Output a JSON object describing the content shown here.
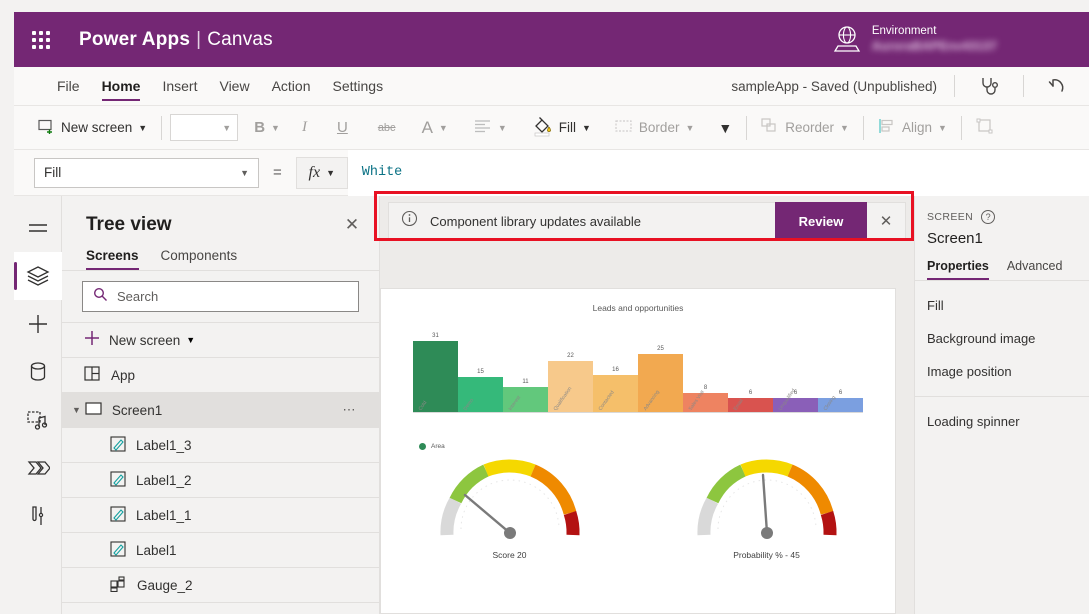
{
  "topbar": {
    "waffle_icon": "app-launcher-icon",
    "brand_product": "Power Apps",
    "brand_separator": "|",
    "brand_mode": "Canvas",
    "environment_icon": "environment-globe-icon",
    "environment_label": "Environment",
    "environment_name": "AuroraBAPEnv43137",
    "accent_color": "#742774"
  },
  "menubar": {
    "items": [
      {
        "label": "File",
        "active": false
      },
      {
        "label": "Home",
        "active": true
      },
      {
        "label": "Insert",
        "active": false
      },
      {
        "label": "View",
        "active": false
      },
      {
        "label": "Action",
        "active": false
      },
      {
        "label": "Settings",
        "active": false
      }
    ],
    "app_status": "sampleApp - Saved (Unpublished)",
    "checker_icon": "app-checker-stethoscope-icon",
    "undo_icon": "undo-icon"
  },
  "ribbon": {
    "new_screen_label": "New screen",
    "new_screen_icon": "new-screen-icon",
    "font_family_value": "",
    "bold_label": "B",
    "italic_label": "I",
    "underline_label": "U",
    "strikethrough_label": "abc",
    "font_color_label": "A",
    "align_icon": "align-left-icon",
    "fill_label": "Fill",
    "fill_icon": "paint-bucket-icon",
    "border_label": "Border",
    "border_icon": "border-icon",
    "overflow_icon": "chevron-down-icon",
    "reorder_label": "Reorder",
    "reorder_icon": "reorder-icon",
    "align_label": "Align",
    "align_label_icon": "align-objects-icon",
    "group_icon": "group-icon"
  },
  "formulabar": {
    "property_value": "Fill",
    "equals": "=",
    "fx_label": "fx",
    "formula_value": "White"
  },
  "rail": {
    "items": [
      {
        "name": "menu-hamburger-icon",
        "active": false
      },
      {
        "name": "tree-view-layers-icon",
        "active": true
      },
      {
        "name": "insert-plus-icon",
        "active": false
      },
      {
        "name": "data-cylinder-icon",
        "active": false
      },
      {
        "name": "media-icon",
        "active": false
      },
      {
        "name": "power-automate-icon",
        "active": false
      },
      {
        "name": "variables-tools-icon",
        "active": false
      }
    ]
  },
  "treeview": {
    "title": "Tree view",
    "close_icon": "close-icon",
    "tabs": [
      {
        "label": "Screens",
        "active": true
      },
      {
        "label": "Components",
        "active": false
      }
    ],
    "search_placeholder": "Search",
    "search_icon": "search-icon",
    "search_value": "",
    "new_screen_label": "New screen",
    "items": [
      {
        "label": "App",
        "icon": "app-icon",
        "level": 0,
        "selected": false,
        "expandable": false,
        "more": false
      },
      {
        "label": "Screen1",
        "icon": "screen-icon",
        "level": 0,
        "selected": true,
        "expandable": true,
        "more": true
      },
      {
        "label": "Label1_3",
        "icon": "label-icon",
        "level": 1,
        "selected": false,
        "expandable": false,
        "more": false
      },
      {
        "label": "Label1_2",
        "icon": "label-icon",
        "level": 1,
        "selected": false,
        "expandable": false,
        "more": false
      },
      {
        "label": "Label1_1",
        "icon": "label-icon",
        "level": 1,
        "selected": false,
        "expandable": false,
        "more": false
      },
      {
        "label": "Label1",
        "icon": "label-icon",
        "level": 1,
        "selected": false,
        "expandable": false,
        "more": false
      },
      {
        "label": "Gauge_2",
        "icon": "component-icon",
        "level": 1,
        "selected": false,
        "expandable": false,
        "more": false
      }
    ]
  },
  "notification": {
    "info_icon": "info-icon",
    "message": "Component library updates available",
    "button_label": "Review",
    "close_icon": "close-icon",
    "highlight_color": "#e81123"
  },
  "properties_panel": {
    "kicker": "SCREEN",
    "help_icon": "help-circle-icon",
    "selected_name": "Screen1",
    "tabs": [
      {
        "label": "Properties",
        "active": true
      },
      {
        "label": "Advanced",
        "active": false
      }
    ],
    "rows_group1": [
      "Fill",
      "Background image",
      "Image position"
    ],
    "rows_group2": [
      "Loading spinner"
    ]
  },
  "chart_data": [
    {
      "type": "bar",
      "title": "Leads and opportunities",
      "categories": [
        "Cold",
        "Demo",
        "Interest",
        "Qualification",
        "Contacted",
        "Advancing",
        "Sales Visit",
        "Email",
        "Unqualified",
        "Closing"
      ],
      "values": [
        31,
        15,
        11,
        22,
        16,
        25,
        8,
        6,
        6,
        6
      ],
      "colors": [
        "#2e8b57",
        "#35b97a",
        "#62c87c",
        "#f7c98b",
        "#f5bf6a",
        "#f2a950",
        "#ee8361",
        "#d9534f",
        "#8a5fb8",
        "#7b9fe0"
      ],
      "legend": [
        "Area"
      ],
      "legend_position": "bottom-left",
      "xlabel": "",
      "ylabel": "",
      "ylim": [
        0,
        34
      ],
      "grid": false
    },
    {
      "type": "gauge",
      "title": "Score",
      "label": "Score   20",
      "value": 20,
      "min": 0,
      "max": 100,
      "bands": [
        {
          "color": "#d9d9d9",
          "from": 0,
          "to": 10
        },
        {
          "color": "#8dc63f",
          "from": 10,
          "to": 35
        },
        {
          "color": "#f5d800",
          "from": 35,
          "to": 58
        },
        {
          "color": "#ef8a00",
          "from": 58,
          "to": 85
        },
        {
          "color": "#b31212",
          "from": 85,
          "to": 100
        }
      ]
    },
    {
      "type": "gauge",
      "title": "Probability %",
      "label": "Probability % -  45",
      "value": 45,
      "min": 0,
      "max": 100,
      "bands": [
        {
          "color": "#d9d9d9",
          "from": 0,
          "to": 10
        },
        {
          "color": "#8dc63f",
          "from": 10,
          "to": 35
        },
        {
          "color": "#f5d800",
          "from": 35,
          "to": 58
        },
        {
          "color": "#ef8a00",
          "from": 58,
          "to": 85
        },
        {
          "color": "#b31212",
          "from": 85,
          "to": 100
        }
      ]
    }
  ]
}
